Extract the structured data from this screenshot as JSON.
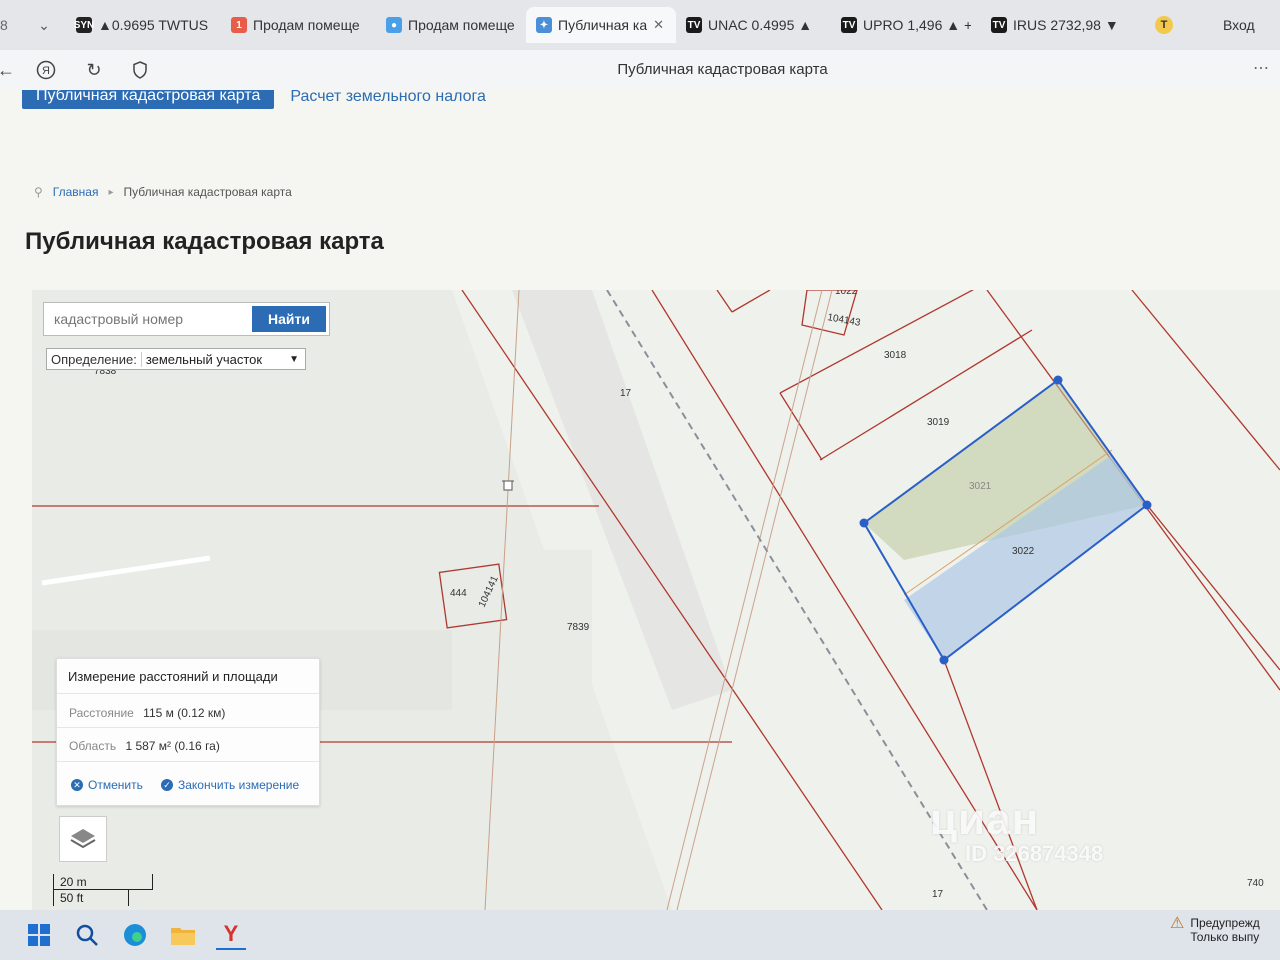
{
  "browser": {
    "tabs": [
      {
        "label": "▲0.9695 TWTUS",
        "icon": "ticker-icon",
        "icon_color": "#222222",
        "icon_text": "SYN"
      },
      {
        "label": "Продам помеще",
        "icon": "notification-icon",
        "icon_color": "#e85c4a",
        "icon_text": "1"
      },
      {
        "label": "Продам помеще",
        "icon": "cian-icon",
        "icon_color": "#4aa0e8",
        "icon_text": "●"
      },
      {
        "label": "Публичная ка",
        "icon": "map-icon",
        "icon_color": "#4a8fd8",
        "icon_text": "✦",
        "active": true
      },
      {
        "label": "UNAC 0.4995 ▲",
        "icon": "tradingview-icon",
        "icon_color": "#1a1a1a",
        "icon_text": "TV"
      },
      {
        "label": "UPRO 1,496 ▲ +",
        "icon": "tradingview-icon",
        "icon_color": "#1a1a1a",
        "icon_text": "TV"
      },
      {
        "label": "IRUS 2732,98 ▼",
        "icon": "tradingview-icon",
        "icon_color": "#1a1a1a",
        "icon_text": "TV"
      }
    ],
    "login_label": "Вход",
    "page_title": "Публичная кадастровая карта"
  },
  "site": {
    "nav_primary": "Публичная кадастровая карта",
    "nav_secondary": "Расчет земельного налога",
    "breadcrumb_home": "Главная",
    "breadcrumb_current": "Публичная кадастровая карта",
    "title": "Публичная кадастровая карта"
  },
  "map": {
    "search_placeholder": "кадастровый номер",
    "search_button": "Найти",
    "definition_label": "Определение:",
    "definition_value": "земельный участок",
    "parcel_labels": [
      "7838",
      "17",
      "3018",
      "3019",
      "3021",
      "3022",
      "444",
      "104141",
      "104143",
      "1022",
      "7839",
      "17",
      "740"
    ],
    "measure": {
      "title": "Измерение расстояний и площади",
      "distance_label": "Расстояние",
      "distance_value": "115 м (0.12 км)",
      "area_label": "Область",
      "area_value": "1 587 м² (0.16 га)",
      "cancel": "Отменить",
      "finish": "Закончить измерение"
    },
    "scale_metric": "20 m",
    "scale_imperial": "50 ft",
    "watermark_logo": "циан",
    "watermark_id": "ID 326874348",
    "colors": {
      "boundary": "#b0382e",
      "selection": "#2a5fc8",
      "selection_fill_top": "#b9c79a",
      "selection_fill_bottom": "#a9c6e6"
    }
  },
  "taskbar": {
    "notice_line1": "Предупрежд",
    "notice_line2": "Только выпу"
  }
}
